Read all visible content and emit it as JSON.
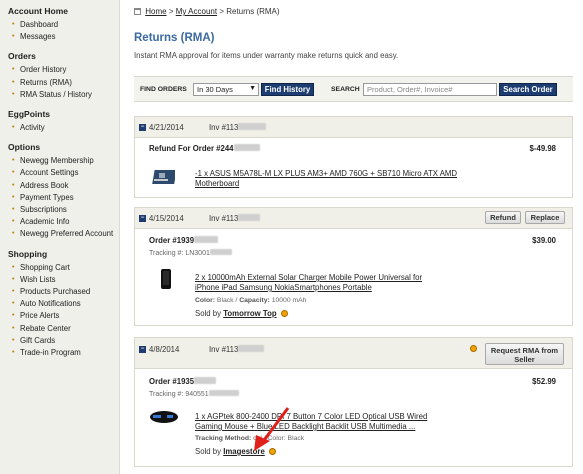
{
  "sidebar": {
    "sections": [
      {
        "title": "Account Home",
        "items": [
          "Dashboard",
          "Messages"
        ]
      },
      {
        "title": "Orders",
        "items": [
          "Order History",
          "Returns (RMA)",
          "RMA Status / History"
        ]
      },
      {
        "title": "EggPoints",
        "items": [
          "Activity"
        ]
      },
      {
        "title": "Options",
        "items": [
          "Newegg Membership",
          "Account Settings",
          "Address Book",
          "Payment Types",
          "Subscriptions",
          "Academic Info",
          "Newegg Preferred Account"
        ]
      },
      {
        "title": "Shopping",
        "items": [
          "Shopping Cart",
          "Wish Lists",
          "Products Purchased",
          "Auto Notifications",
          "Price Alerts",
          "Rebate Center",
          "Gift Cards",
          "Trade-in Program"
        ]
      }
    ]
  },
  "breadcrumb": {
    "home": "Home",
    "sep1": ">",
    "account": "My Account",
    "sep2": ">",
    "current": "Returns (RMA)"
  },
  "page": {
    "title": "Returns (RMA)",
    "subtitle": "Instant RMA approval for items under warranty make returns quick and easy."
  },
  "filter": {
    "find_label": "FIND ORDERS",
    "range_value": "In 30 Days",
    "find_button": "Find History",
    "search_label": "SEARCH",
    "search_placeholder": "Product, Order#, Invoice#",
    "search_button": "Search Order"
  },
  "orders": [
    {
      "date": "4/21/2014",
      "inv_prefix": "Inv #",
      "inv_visible": "113",
      "order_label": "Refund For Order #244",
      "amount": "$-49.98",
      "product": "-1 x ASUS M5A78L-M LX PLUS AM3+ AMD 760G + SB710 Micro ATX AMD Motherboard"
    },
    {
      "date": "4/15/2014",
      "inv_prefix": "Inv #",
      "inv_visible": "113",
      "buttons": [
        "Refund",
        "Replace"
      ],
      "order_label": "Order #1939",
      "amount": "$39.00",
      "tracking_label": "Tracking #:",
      "tracking_visible": "LN3001",
      "product": "2 x 10000mAh External Solar Charger Mobile Power Universal for iPhone iPad Samsung NokiaSmartphones Portable",
      "meta_color_label": "Color:",
      "meta_color": "Black",
      "meta_cap_label": "Capacity:",
      "meta_cap": "10000 mAh",
      "sold_by": "Sold by",
      "seller": "Tomorrow Top"
    },
    {
      "date": "4/8/2014",
      "inv_prefix": "Inv #",
      "inv_visible": "113",
      "button": "Request RMA from Seller",
      "order_label": "Order #1935",
      "amount": "$52.99",
      "tracking_label": "Tracking #:",
      "tracking_visible": "940551",
      "product": "1 x AGPtek 800-2400 DPI 7 Button 7 Color LED Optical USB Wired Gaming Mouse + Blue LED Backlight Backlit USB Multimedia ...",
      "meta_method_label": "Tracking Method:",
      "meta_method": "cal / Color: Black",
      "sold_by": "Sold by",
      "seller": "Imagestore"
    }
  ],
  "colors": {
    "title": "#3a6aa0",
    "button_dark": "#1d3d72",
    "sidebar_bg": "#f0f0ea",
    "annotation_arrow": "#e0201a"
  },
  "icons": {
    "home": "home-icon",
    "collapse": "collapse-minus-icon",
    "seller_rating": "smiley-rating-icon",
    "arrow": "red-arrow-annotation"
  }
}
